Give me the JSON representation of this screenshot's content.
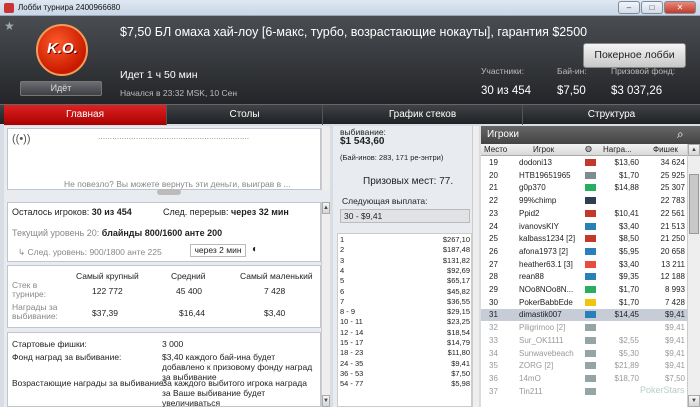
{
  "window": {
    "title": "Лобби турнира 2400966680",
    "minimize": "–",
    "maximize": "□",
    "close": "✕"
  },
  "header": {
    "logo_text": "K.O.",
    "status_chip": "Идёт",
    "tournament_name": "$7,50 БЛ омаха хай-лоу [6-макс, турбо, возрастающие нокауты], гарантия $2500",
    "lobby_button": "Покерное лобби",
    "running_time": "Идет 1 ч 50 мин",
    "started": "Начался в 23:32 MSK, 10 Сен",
    "players_label": "Участники:",
    "players_value": "30 из 454",
    "buyin_label": "Бай-ин:",
    "buyin_value": "$7,50",
    "prize_label": "Призовой фонд:",
    "prize_value": "$3 037,26"
  },
  "tabs": [
    "Главная",
    "Столы",
    "График стеков",
    "Структура"
  ],
  "left": {
    "notice_line1": "................................................................",
    "notice_line2": "Не повезло? Вы можете вернуть эти деньги, выиграв в ...",
    "remaining_label": "Осталось игроков:",
    "remaining_value": "30 из 454",
    "break_label": "След. перерыв:",
    "break_value": "через 32 мин",
    "level_label": "Текущий уровень 20:",
    "level_value": "блайнды 800/1600 анте 200",
    "next_level_label": "След. уровень:",
    "next_level_value": "900/1800 анте 225",
    "next_level_time": "через 2 мин",
    "stack_headers": [
      "Самый крупный",
      "Средний",
      "Самый маленький"
    ],
    "stack_row_label": "Стек в турнире:",
    "stack_values": [
      "122 772",
      "45 400",
      "7 428"
    ],
    "bounty_row_label": "Награды за выбивание:",
    "bounty_values": [
      "$37,39",
      "$16,44",
      "$3,40"
    ],
    "chips_label": "Стартовые фишки:",
    "chips_value": "3 000",
    "bounty_fund_label": "Фонд наград за выбивание:",
    "bounty_fund_value": "$3,40 каждого бай-ина будет добавлено к призовому фонду наград за выбивание",
    "increasing_label": "Возрастающие награды за выбивание:",
    "increasing_value": "За каждого выбитого игрока награда за Ваше выбивание будет увеличиваться"
  },
  "middle": {
    "bounty_label": "выбивание:",
    "bounty_value": "$1 543,60",
    "buyins_note": "(Бай-инов: 283, 171 ре-энтри)",
    "paid_places": "Призовых мест: 77.",
    "next_payout_label": "Следующая выплата:",
    "next_payout_value": "30 - $9,41",
    "payouts": [
      {
        "place": "1",
        "amount": "$267,10"
      },
      {
        "place": "2",
        "amount": "$187,48"
      },
      {
        "place": "3",
        "amount": "$131,82"
      },
      {
        "place": "4",
        "amount": "$92,69"
      },
      {
        "place": "5",
        "amount": "$65,17"
      },
      {
        "place": "6",
        "amount": "$45,82"
      },
      {
        "place": "7",
        "amount": "$36,55"
      },
      {
        "place": "8 - 9",
        "amount": "$29,15"
      },
      {
        "place": "10 - 11",
        "amount": "$23,25"
      },
      {
        "place": "12 - 14",
        "amount": "$18,54"
      },
      {
        "place": "15 - 17",
        "amount": "$14,79"
      },
      {
        "place": "18 - 23",
        "amount": "$11,80"
      },
      {
        "place": "24 - 35",
        "amount": "$9,41"
      },
      {
        "place": "36 - 53",
        "amount": "$7,50"
      },
      {
        "place": "54 - 77",
        "amount": "$5,98"
      }
    ]
  },
  "players": {
    "title": "Игроки",
    "columns": [
      "Место",
      "Игрок",
      "Награ...",
      "Фишек"
    ],
    "rows": [
      {
        "place": "19",
        "name": "dodoni13",
        "bounty": "$13,60",
        "chips": "34 624",
        "flag": "#c0392b"
      },
      {
        "place": "20",
        "name": "HTB19651965",
        "bounty": "$1,70",
        "chips": "25 925",
        "flag": "#7f8c8d"
      },
      {
        "place": "21",
        "name": "g0p370",
        "bounty": "$14,88",
        "chips": "25 307",
        "flag": "#27ae60"
      },
      {
        "place": "22",
        "name": "99%chimp",
        "bounty": "",
        "chips": "22 783",
        "flag": "#2c3e50"
      },
      {
        "place": "23",
        "name": "Ppid2",
        "bounty": "$10,41",
        "chips": "22 561",
        "flag": "#c0392b"
      },
      {
        "place": "24",
        "name": "ivanovsKIY",
        "bounty": "$3,40",
        "chips": "21 513",
        "flag": "#2980b9"
      },
      {
        "place": "25",
        "name": "kalbass1234 [2]",
        "bounty": "$8,50",
        "chips": "21 250",
        "flag": "#c0392b"
      },
      {
        "place": "26",
        "name": "afona1973 [2]",
        "bounty": "$5,95",
        "chips": "20 658",
        "flag": "#2980b9"
      },
      {
        "place": "27",
        "name": "heather63.1 [3]",
        "bounty": "$3,40",
        "chips": "13 211",
        "flag": "#e74c3c"
      },
      {
        "place": "28",
        "name": "rean88",
        "bounty": "$9,35",
        "chips": "12 188",
        "flag": "#2980b9"
      },
      {
        "place": "29",
        "name": "NOo8NOo8N...",
        "bounty": "$1,70",
        "chips": "8 993",
        "flag": "#27ae60"
      },
      {
        "place": "30",
        "name": "PokerBabbEde",
        "bounty": "$1,70",
        "chips": "7 428",
        "flag": "#f1c40f"
      },
      {
        "place": "31",
        "name": "dimastik007",
        "bounty": "$14,45",
        "chips": "$9,41",
        "flag": "#2980b9",
        "selected": true
      },
      {
        "place": "32",
        "name": "Piligrimoo [2]",
        "bounty": "",
        "chips": "$9,41",
        "flag": "#95a5a6",
        "out": true
      },
      {
        "place": "33",
        "name": "Sur_OK1111",
        "bounty": "$2,55",
        "chips": "$9,41",
        "flag": "#95a5a6",
        "out": true
      },
      {
        "place": "34",
        "name": "Sunwavebeach",
        "bounty": "$5,30",
        "chips": "$9,41",
        "flag": "#95a5a6",
        "out": true
      },
      {
        "place": "35",
        "name": "ZORG [2]",
        "bounty": "$21,89",
        "chips": "$9,41",
        "flag": "#95a5a6",
        "out": true
      },
      {
        "place": "36",
        "name": "14mO",
        "bounty": "$18,70",
        "chips": "$7,50",
        "flag": "#95a5a6",
        "out": true
      },
      {
        "place": "37",
        "name": "Tin211",
        "bounty": "",
        "chips": "",
        "flag": "#95a5a6",
        "out": true
      }
    ]
  },
  "watermark": "PokerStars"
}
